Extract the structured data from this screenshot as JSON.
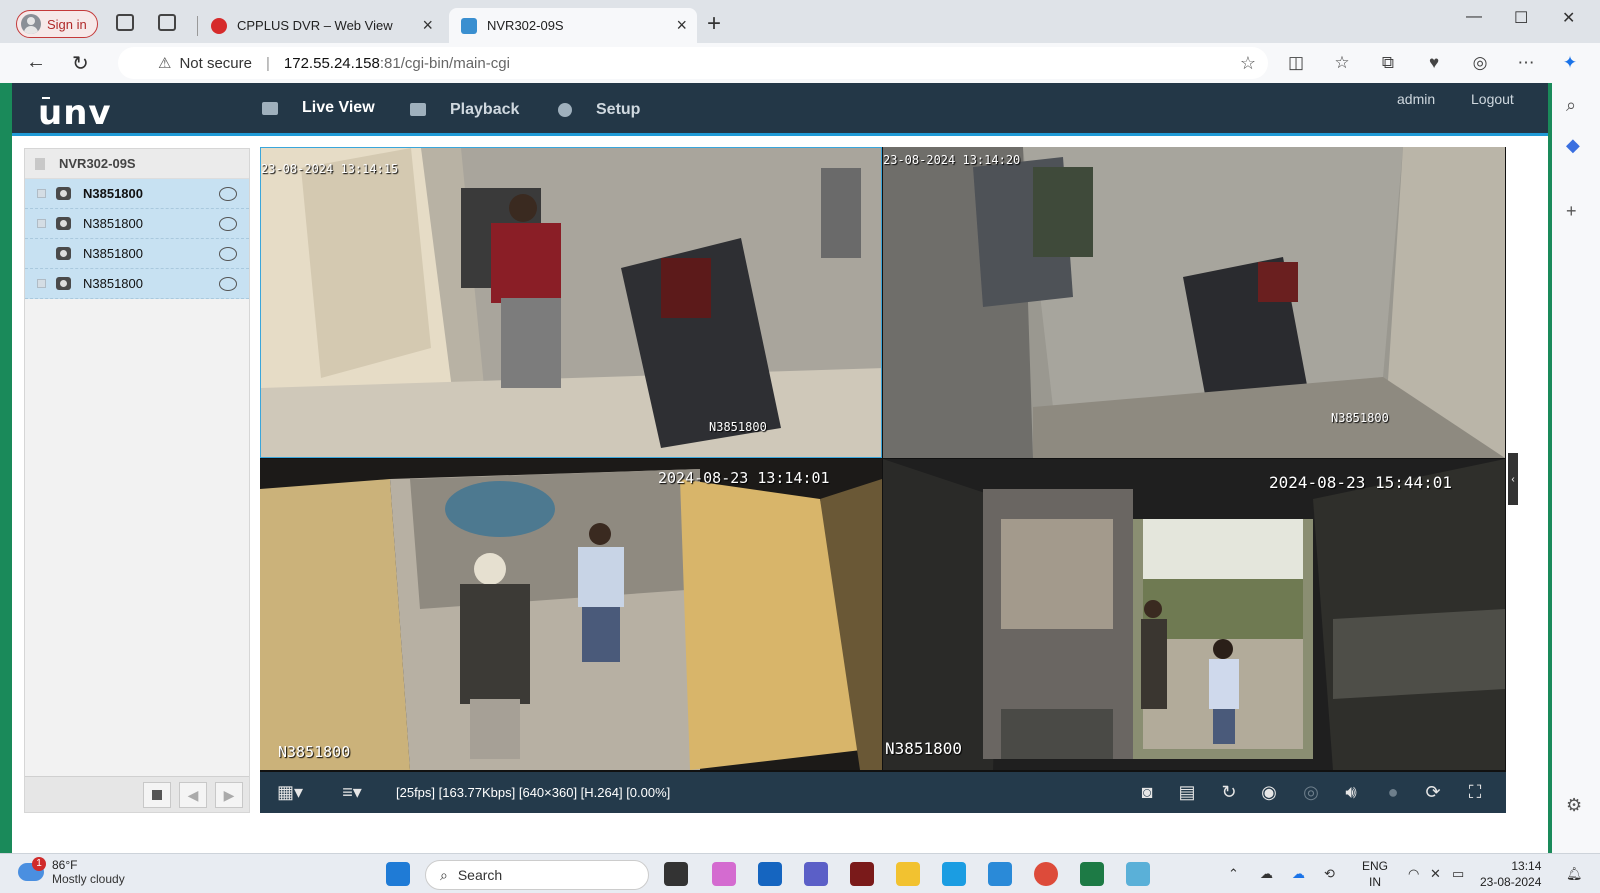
{
  "browser": {
    "sign_in": "Sign in",
    "tabs": [
      {
        "title": "CPPLUS DVR – Web View"
      },
      {
        "title": "NVR302-09S"
      }
    ],
    "security": "Not secure",
    "url_host": "172.55.24.158",
    "url_rest": ":81/cgi-bin/main-cgi"
  },
  "app": {
    "logo": "unv",
    "nav": [
      {
        "label": "Live View"
      },
      {
        "label": "Playback"
      },
      {
        "label": "Setup"
      }
    ],
    "user": "admin",
    "logout": "Logout"
  },
  "devices": {
    "nvr_name": "NVR302-09S",
    "channels": [
      {
        "name": "N3851800"
      },
      {
        "name": "N3851800"
      },
      {
        "name": "N3851800"
      },
      {
        "name": "N3851800"
      }
    ]
  },
  "video": {
    "cells": [
      {
        "timestamp": "23-08-2024 13:14:15",
        "camera": "N3851800"
      },
      {
        "timestamp": "23-08-2024 13:14:20",
        "camera": "N3851800"
      },
      {
        "timestamp": "2024-08-23 13:14:01",
        "camera": "N3851800"
      },
      {
        "timestamp": "2024-08-23 15:44:01",
        "camera": "N3851800"
      }
    ],
    "status": "[25fps] [163.77Kbps] [640×360] [H.264] [0.00%]"
  },
  "taskbar": {
    "weather_temp": "86°F",
    "weather_desc": "Mostly cloudy",
    "weather_badge": "1",
    "search": "Search",
    "lang1": "ENG",
    "lang2": "IN",
    "time": "13:14",
    "date": "23-08-2024"
  },
  "icons": [
    "search-icon",
    "camera-icon",
    "record-icon",
    "grid-layout-icon",
    "snapshot-icon",
    "fullscreen-icon",
    "volume-icon"
  ],
  "colors": {
    "appbar": "#233747",
    "accent": "#1f9ad6",
    "channel_row": "#c7e1f2"
  }
}
